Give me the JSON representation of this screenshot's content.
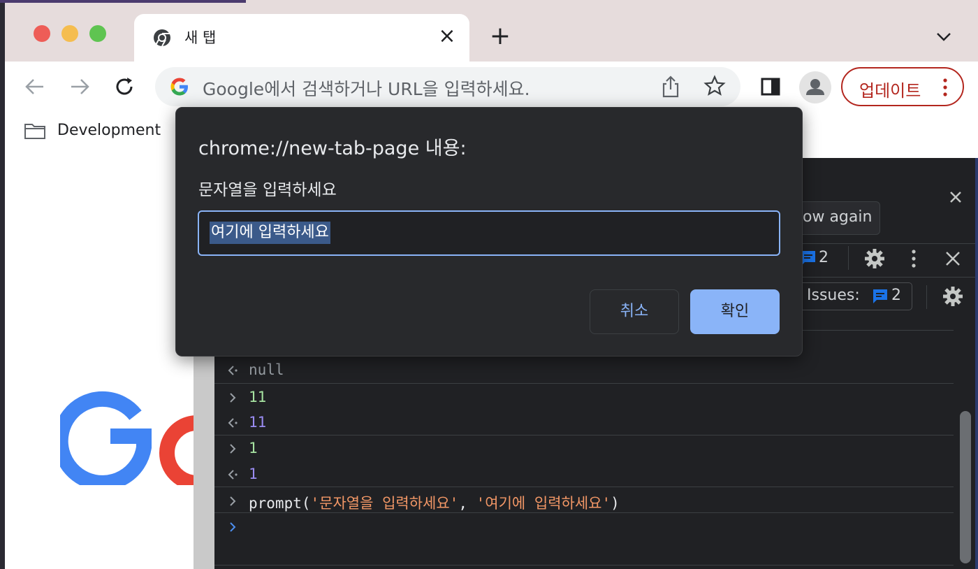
{
  "tab": {
    "title": "새 탭"
  },
  "omnibox": {
    "placeholder": "Google에서 검색하거나 URL을 입력하세요."
  },
  "toolbar": {
    "update_label": "업데이트"
  },
  "bookmarks": {
    "items": [
      {
        "label": "Development"
      }
    ]
  },
  "devtools": {
    "show_again_partial": "ow again",
    "messages_count": "2",
    "issues_label": "2 Issues:",
    "issues_count": "2",
    "console": [
      {
        "type": "output",
        "text": "null",
        "color": "grey"
      },
      {
        "type": "input",
        "text": "11",
        "color": "green"
      },
      {
        "type": "output",
        "text": "11",
        "color": "purple"
      },
      {
        "type": "input",
        "text": "1",
        "color": "green"
      },
      {
        "type": "output",
        "text": "1",
        "color": "purple"
      }
    ],
    "prompt_call": {
      "fn": "prompt(",
      "arg1": "'문자열을 입력하세요'",
      "sep": ", ",
      "arg2": "'여기에 입력하세요'",
      "close": ")"
    }
  },
  "dialog": {
    "title": "chrome://new-tab-page 내용:",
    "message": "문자열을 입력하세요",
    "input_value": "여기에 입력하세요",
    "cancel_label": "취소",
    "ok_label": "확인"
  },
  "colors": {
    "update_accent": "#b3261e",
    "dialog_accent": "#8ab4f8",
    "devtools_bg": "#202124"
  }
}
